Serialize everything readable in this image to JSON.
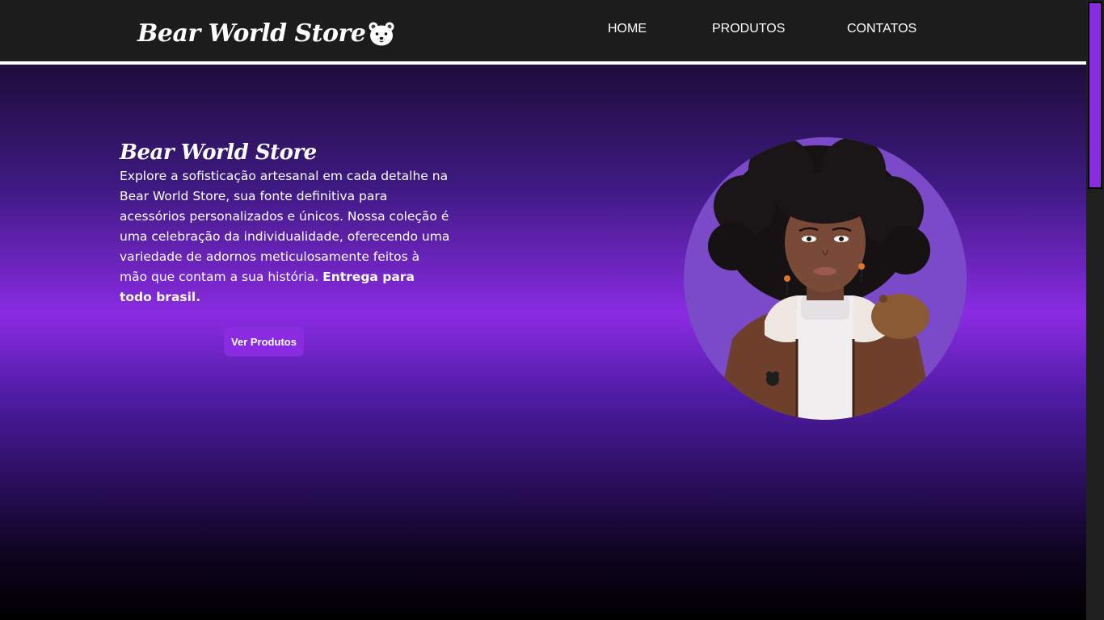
{
  "header": {
    "logo_text": "Bear World Store",
    "logo_icon": "bear-face-icon",
    "nav": [
      {
        "label": "HOME"
      },
      {
        "label": "PRODUTOS"
      },
      {
        "label": "CONTATOS"
      }
    ]
  },
  "hero": {
    "title": "Bear World Store",
    "description": "Explore a sofisticação artesanal em cada detalhe na Bear World Store, sua fonte definitiva para acessórios personalizados e únicos. Nossa coleção é uma celebração da individualidade, oferecendo uma variedade de adornos meticulosamente feitos à mão que contam a sua história.",
    "description_bold": "Entrega para todo brasil.",
    "cta_label": "Ver Produtos",
    "image": "illustrated-portrait-woman-with-bear"
  },
  "colors": {
    "accent": "#8a2be2",
    "header_bg": "#1c1c1c",
    "portrait_bg": "#7b4ac8",
    "text": "#ffffff"
  }
}
